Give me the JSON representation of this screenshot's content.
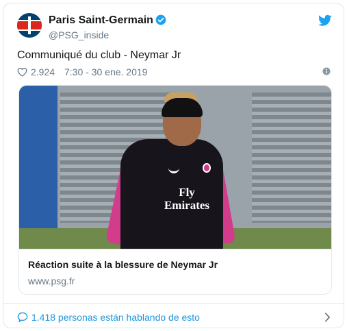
{
  "account": {
    "display_name": "Paris Saint-Germain",
    "handle": "@PSG_inside",
    "avatar_text": "PARIS",
    "verified": true
  },
  "tweet": {
    "text": "Communiqué du club - Neymar Jr",
    "likes": "2.924",
    "timestamp": "7:30 - 30 ene. 2019"
  },
  "link_card": {
    "title": "Réaction suite à la blessure de Neymar Jr",
    "domain": "www.psg.fr",
    "shirt_text_line1": "Fly",
    "shirt_text_line2": "Emirates"
  },
  "footer": {
    "talking_text": "1.418 personas están hablando de esto"
  },
  "colors": {
    "brand_blue": "#1da1f2",
    "link_blue": "#1b95e0",
    "secondary_text": "#657786",
    "border": "#e1e8ed",
    "psg_navy": "#004170",
    "psg_red": "#da291c"
  },
  "icons": [
    "verified-icon",
    "twitter-bird-icon",
    "heart-icon",
    "info-icon",
    "comment-icon",
    "chevron-right-icon"
  ]
}
